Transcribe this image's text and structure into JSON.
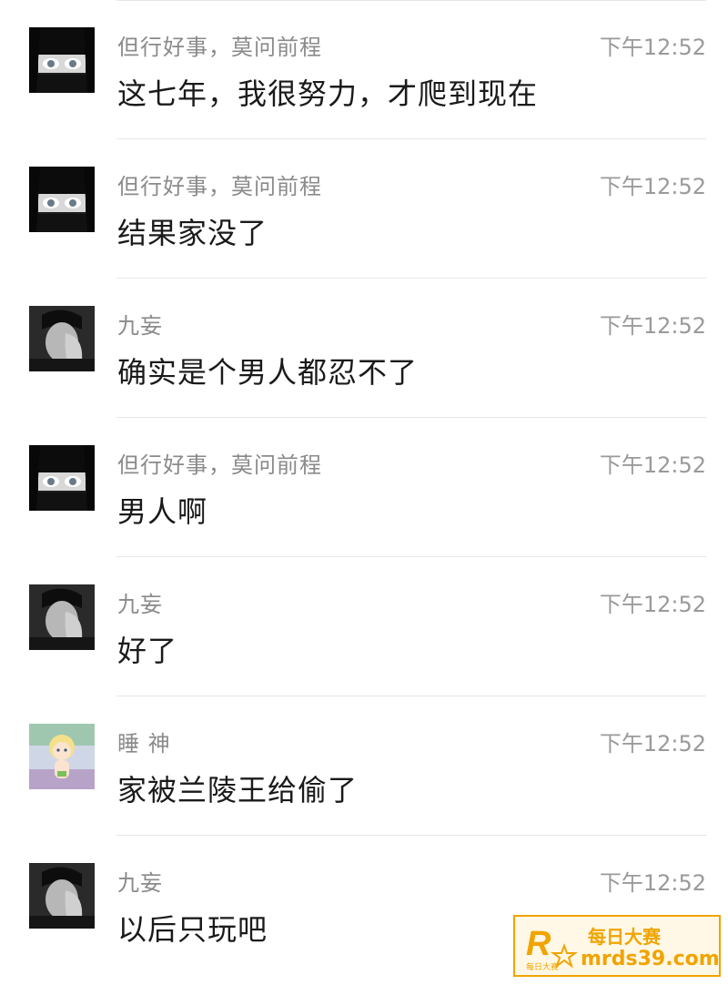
{
  "messages": [
    {
      "avatar": "dark-hair-girl-avatar",
      "sender": "但行好事，莫问前程",
      "time": "下午12:52",
      "text": "这七年，我很努力，才爬到现在"
    },
    {
      "avatar": "dark-hair-girl-avatar",
      "sender": "但行好事，莫问前程",
      "time": "下午12:52",
      "text": "结果家没了"
    },
    {
      "avatar": "man-face-palm-avatar",
      "sender": "九妄",
      "time": "下午12:52",
      "text": "确实是个男人都忍不了"
    },
    {
      "avatar": "dark-hair-girl-avatar",
      "sender": "但行好事，莫问前程",
      "time": "下午12:52",
      "text": "男人啊"
    },
    {
      "avatar": "man-face-palm-avatar",
      "sender": "九妄",
      "time": "下午12:52",
      "text": "好了"
    },
    {
      "avatar": "anime-blonde-child-avatar",
      "sender": "睡 神",
      "time": "下午12:52",
      "text": "家被兰陵王给偷了"
    },
    {
      "avatar": "man-face-palm-avatar",
      "sender": "九妄",
      "time": "下午12:52",
      "text": "以后只玩吧"
    }
  ],
  "watermark": {
    "logo_text": "R",
    "logo_subtext": "每日大赛",
    "title": "每日大赛",
    "url": "mrds39.com",
    "color": "#f0a400"
  }
}
